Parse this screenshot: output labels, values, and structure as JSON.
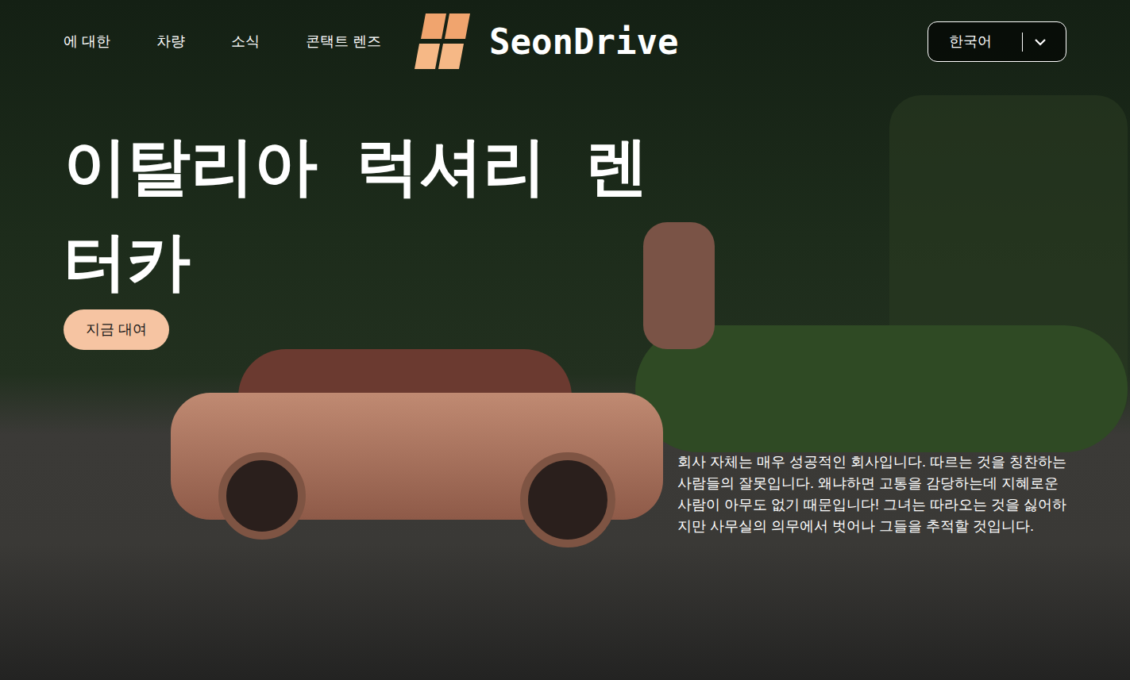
{
  "nav": {
    "items": [
      "에 대한",
      "차량",
      "소식",
      "콘택트 렌즈"
    ]
  },
  "logo": {
    "text": "SeonDrive"
  },
  "language": {
    "label": "한국어"
  },
  "hero": {
    "title": "이탈리아 럭셔리 렌터카",
    "button": "지금 대여",
    "description": "회사 자체는 매우 성공적인 회사입니다. 따르는 것을 칭찬하는 사람들의 잘못입니다. 왜냐하면 고통을 감당하는데 지혜로운 사람이 아무도 없기 때문입니다! 그녀는 따라오는 것을 싫어하지만 사무실의 의무에서 벗어나 그들을 추적할 것입니다."
  }
}
